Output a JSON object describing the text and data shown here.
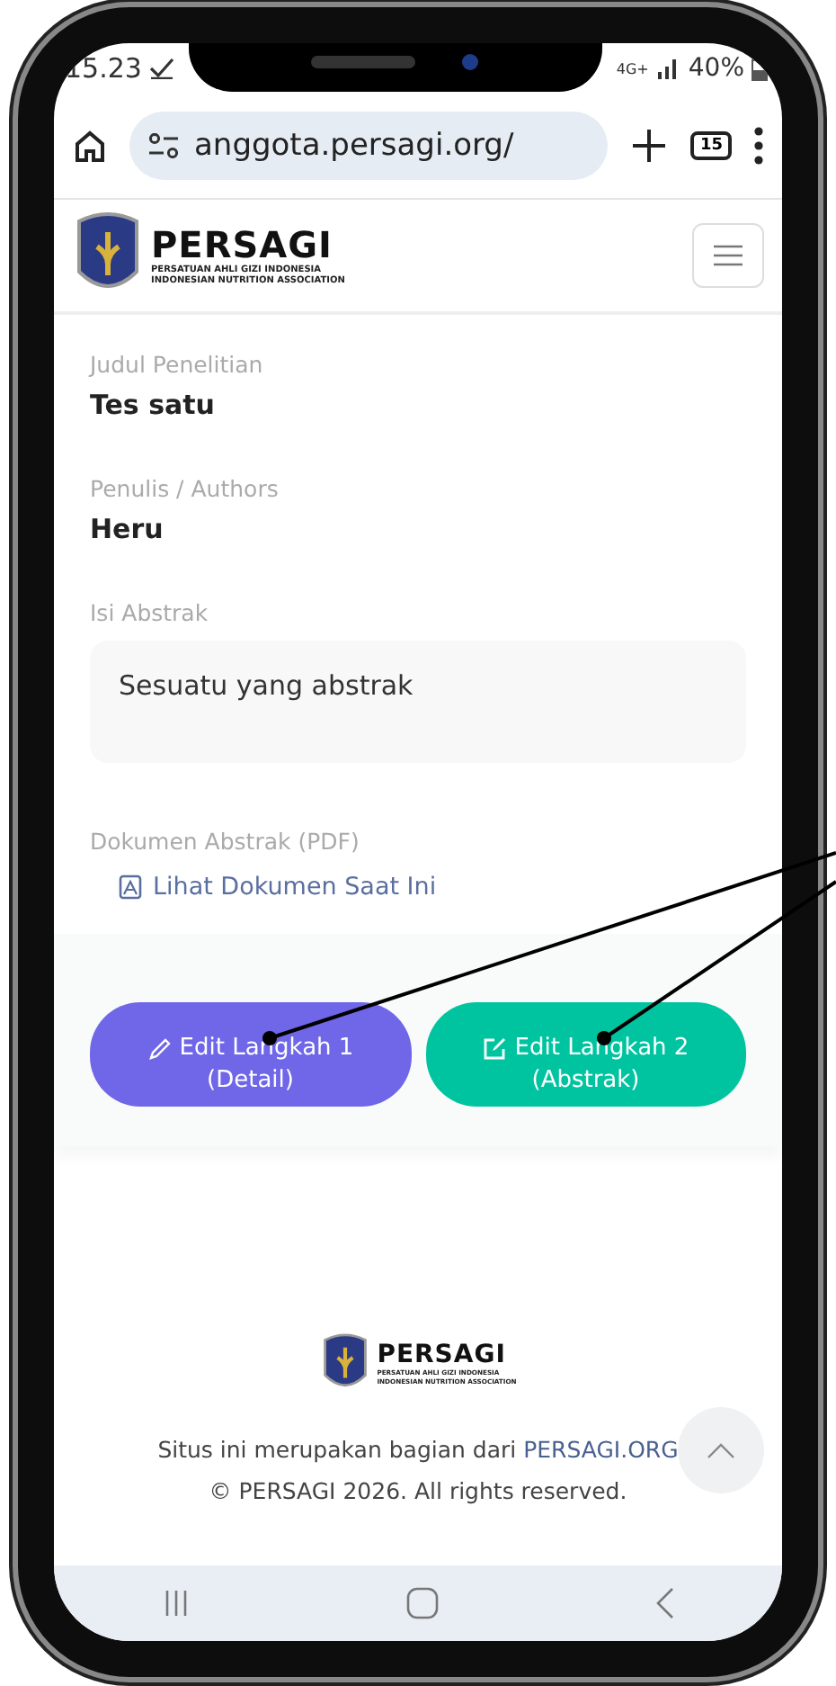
{
  "status_bar": {
    "time": "15.23",
    "network": "4G+",
    "battery": "40%"
  },
  "browser": {
    "url": "anggota.persagi.org/",
    "tab_count": "15"
  },
  "site_header": {
    "brand": "PERSAGI",
    "tagline_1": "PERSATUAN AHLI GIZI INDONESIA",
    "tagline_2": "INDONESIAN NUTRITION ASSOCIATION"
  },
  "fields": [
    {
      "kind": "text",
      "label": "Judul Penelitian",
      "value": "Tes satu"
    },
    {
      "kind": "text",
      "label": "Penulis / Authors",
      "value": "Heru"
    },
    {
      "kind": "box",
      "label": "Isi Abstrak",
      "value": "Sesuatu yang abstrak"
    },
    {
      "kind": "link",
      "label": "Dokumen Abstrak (PDF)",
      "value": "Lihat Dokumen Saat Ini"
    }
  ],
  "actions": [
    {
      "kind": "pencil",
      "line_1": "Edit Langkah 1",
      "line_2": "(Detail)",
      "color": "#6f66e8"
    },
    {
      "kind": "edit",
      "line_1": "Edit Langkah 2",
      "line_2": "(Abstrak)",
      "color": "#00c4a0"
    }
  ],
  "footer": {
    "brand": "PERSAGI",
    "tagline_1": "PERSATUAN AHLI GIZI INDONESIA",
    "tagline_2": "INDONESIAN NUTRITION ASSOCIATION",
    "text": "Situs ini merupakan bagian dari",
    "link": "PERSAGI.ORG",
    "copyright": "© PERSAGI 2026. All rights reserved."
  }
}
